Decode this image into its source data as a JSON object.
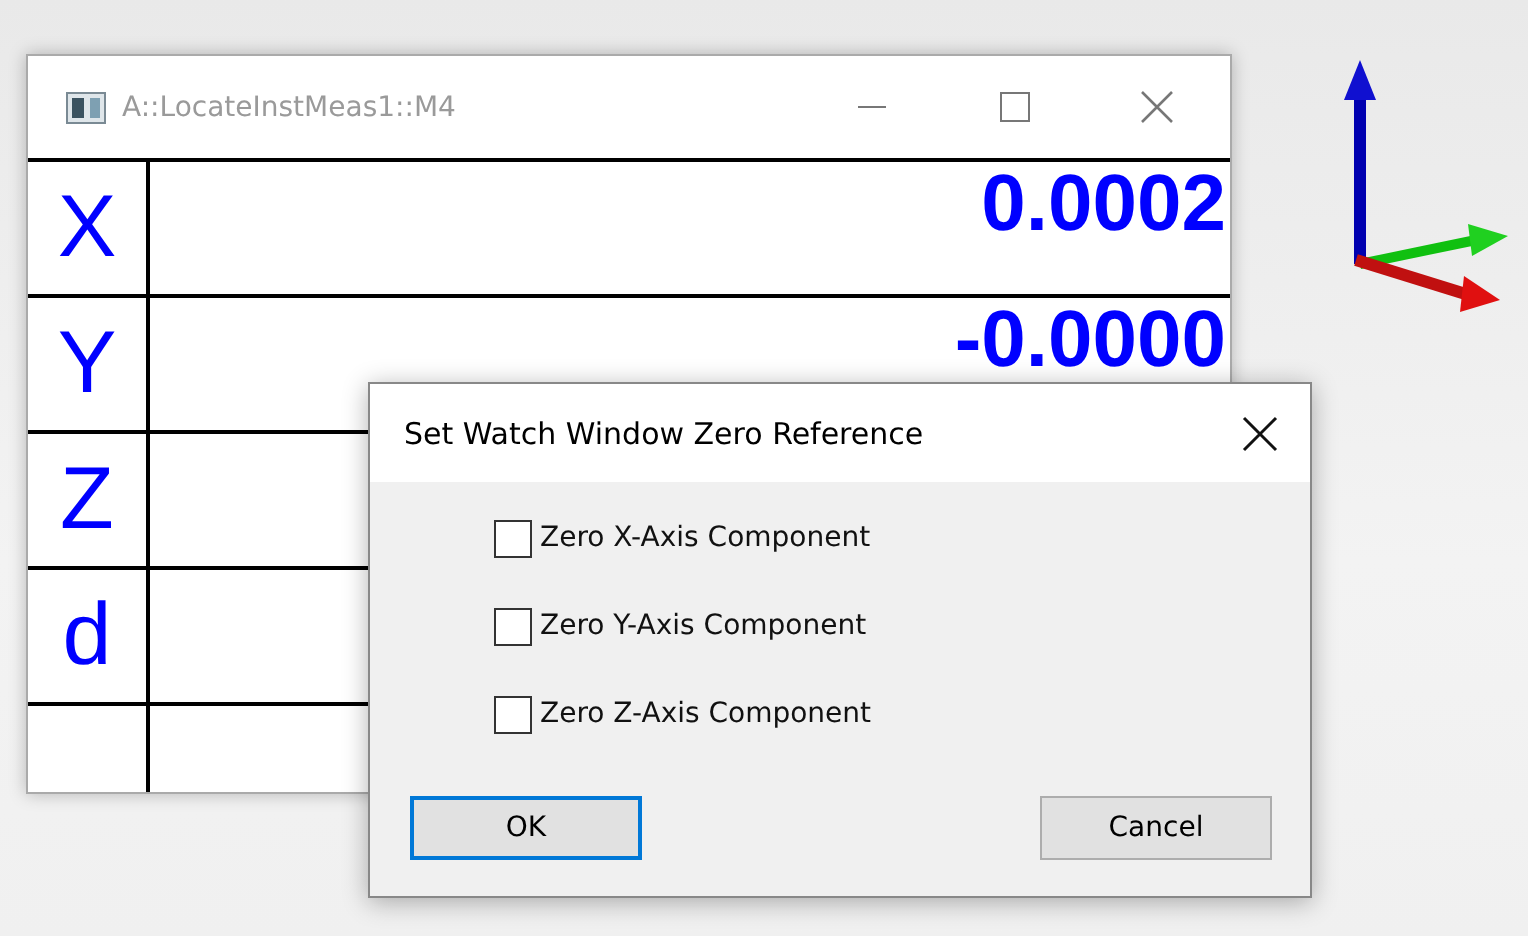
{
  "watch_window": {
    "title": "A::LocateInstMeas1::M4",
    "rows": [
      {
        "label": "X",
        "value": "0.0002"
      },
      {
        "label": "Y",
        "value": "-0.0000"
      },
      {
        "label": "Z"
      },
      {
        "label": "d"
      }
    ]
  },
  "dialog": {
    "title": "Set Watch Window Zero Reference",
    "checkboxes": [
      {
        "label": "Zero X-Axis Component",
        "checked": false
      },
      {
        "label": "Zero Y-Axis Component",
        "checked": false
      },
      {
        "label": "Zero Z-Axis Component",
        "checked": false
      }
    ],
    "buttons": [
      {
        "label": "OK",
        "default": true
      },
      {
        "label": "Cancel",
        "default": false
      }
    ]
  }
}
